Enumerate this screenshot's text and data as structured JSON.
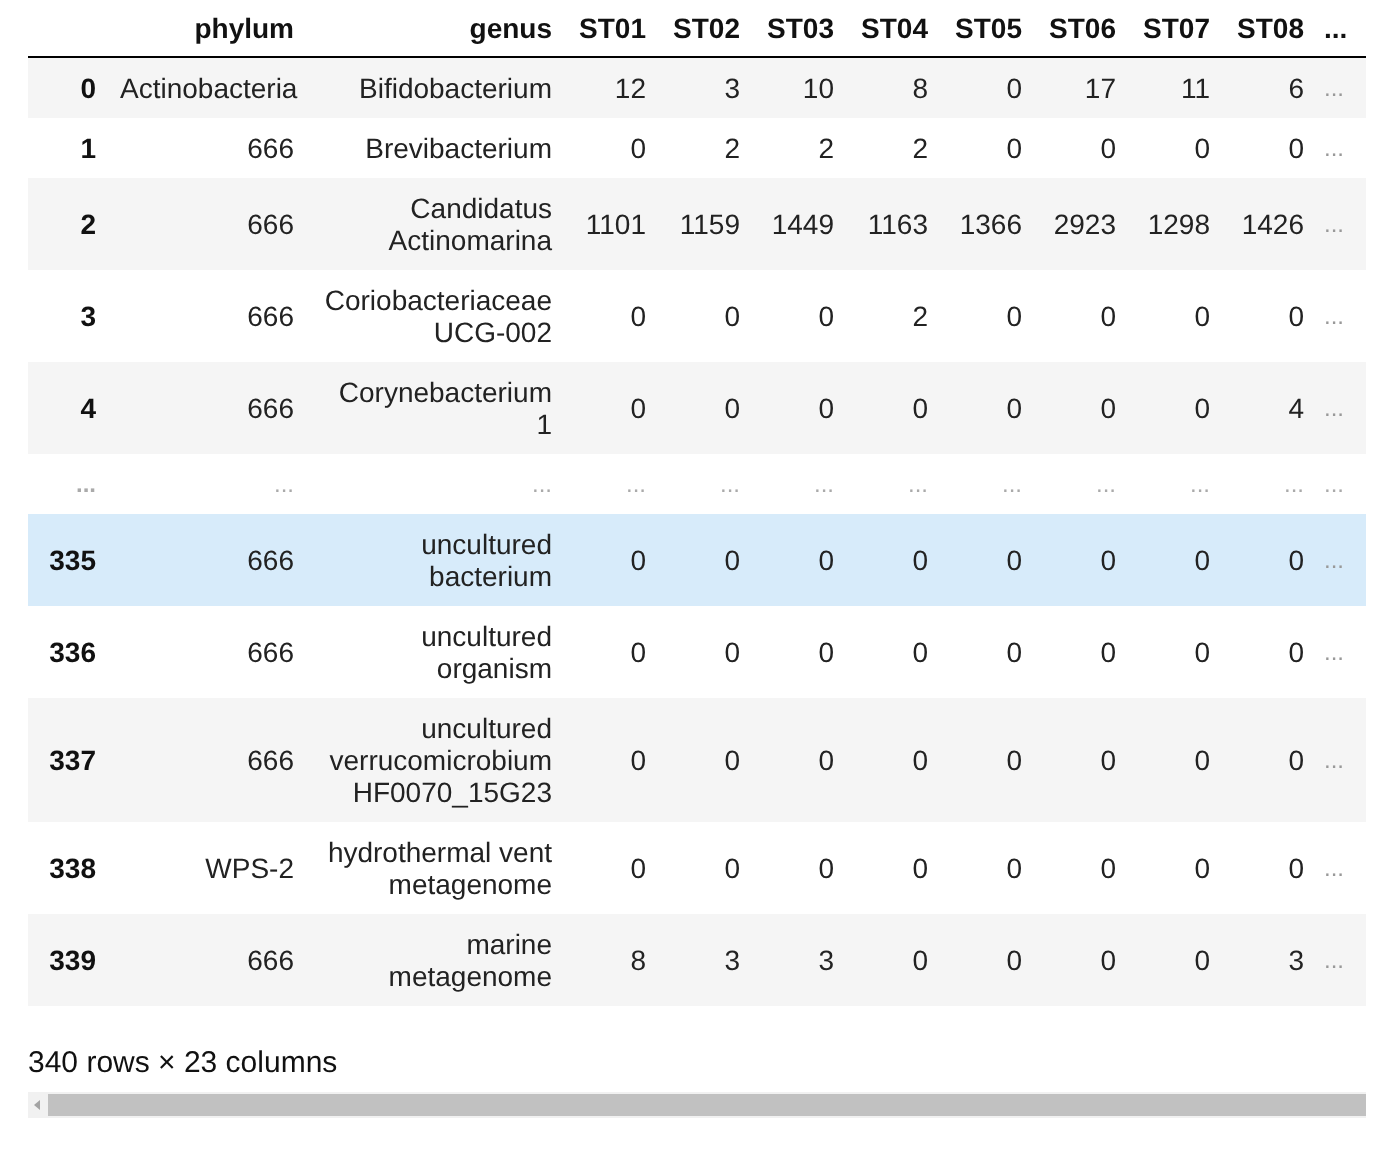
{
  "table": {
    "columns": [
      "phylum",
      "genus",
      "ST01",
      "ST02",
      "ST03",
      "ST04",
      "ST05",
      "ST06",
      "ST07",
      "ST08",
      "..."
    ],
    "rows": [
      {
        "index": "0",
        "kind": "data",
        "hovered": false,
        "cells": [
          "Actinobacteria",
          "Bifidobacterium",
          "12",
          "3",
          "10",
          "8",
          "0",
          "17",
          "11",
          "6",
          "..."
        ]
      },
      {
        "index": "1",
        "kind": "data",
        "hovered": false,
        "cells": [
          "666",
          "Brevibacterium",
          "0",
          "2",
          "2",
          "2",
          "0",
          "0",
          "0",
          "0",
          "..."
        ]
      },
      {
        "index": "2",
        "kind": "data",
        "hovered": false,
        "cells": [
          "666",
          "Candidatus Actinomarina",
          "1101",
          "1159",
          "1449",
          "1163",
          "1366",
          "2923",
          "1298",
          "1426",
          "..."
        ]
      },
      {
        "index": "3",
        "kind": "data",
        "hovered": false,
        "cells": [
          "666",
          "Coriobacteriaceae UCG-002",
          "0",
          "0",
          "0",
          "2",
          "0",
          "0",
          "0",
          "0",
          "..."
        ]
      },
      {
        "index": "4",
        "kind": "data",
        "hovered": false,
        "cells": [
          "666",
          "Corynebacterium 1",
          "0",
          "0",
          "0",
          "0",
          "0",
          "0",
          "0",
          "4",
          "..."
        ]
      },
      {
        "index": "...",
        "kind": "ellipsis",
        "hovered": false,
        "cells": [
          "...",
          "...",
          "...",
          "...",
          "...",
          "...",
          "...",
          "...",
          "...",
          "...",
          "..."
        ]
      },
      {
        "index": "335",
        "kind": "data",
        "hovered": true,
        "cells": [
          "666",
          "uncultured bacterium",
          "0",
          "0",
          "0",
          "0",
          "0",
          "0",
          "0",
          "0",
          "..."
        ]
      },
      {
        "index": "336",
        "kind": "data",
        "hovered": false,
        "cells": [
          "666",
          "uncultured organism",
          "0",
          "0",
          "0",
          "0",
          "0",
          "0",
          "0",
          "0",
          "..."
        ]
      },
      {
        "index": "337",
        "kind": "data",
        "hovered": false,
        "cells": [
          "666",
          "uncultured verrucomicrobium HF0070_15G23",
          "0",
          "0",
          "0",
          "0",
          "0",
          "0",
          "0",
          "0",
          "..."
        ]
      },
      {
        "index": "338",
        "kind": "data",
        "hovered": false,
        "cells": [
          "WPS-2",
          "hydrothermal vent metagenome",
          "0",
          "0",
          "0",
          "0",
          "0",
          "0",
          "0",
          "0",
          "..."
        ]
      },
      {
        "index": "339",
        "kind": "data",
        "hovered": false,
        "cells": [
          "666",
          "marine metagenome",
          "8",
          "3",
          "3",
          "0",
          "0",
          "0",
          "0",
          "3",
          "..."
        ]
      }
    ]
  },
  "footer": "340 rows × 23 columns"
}
